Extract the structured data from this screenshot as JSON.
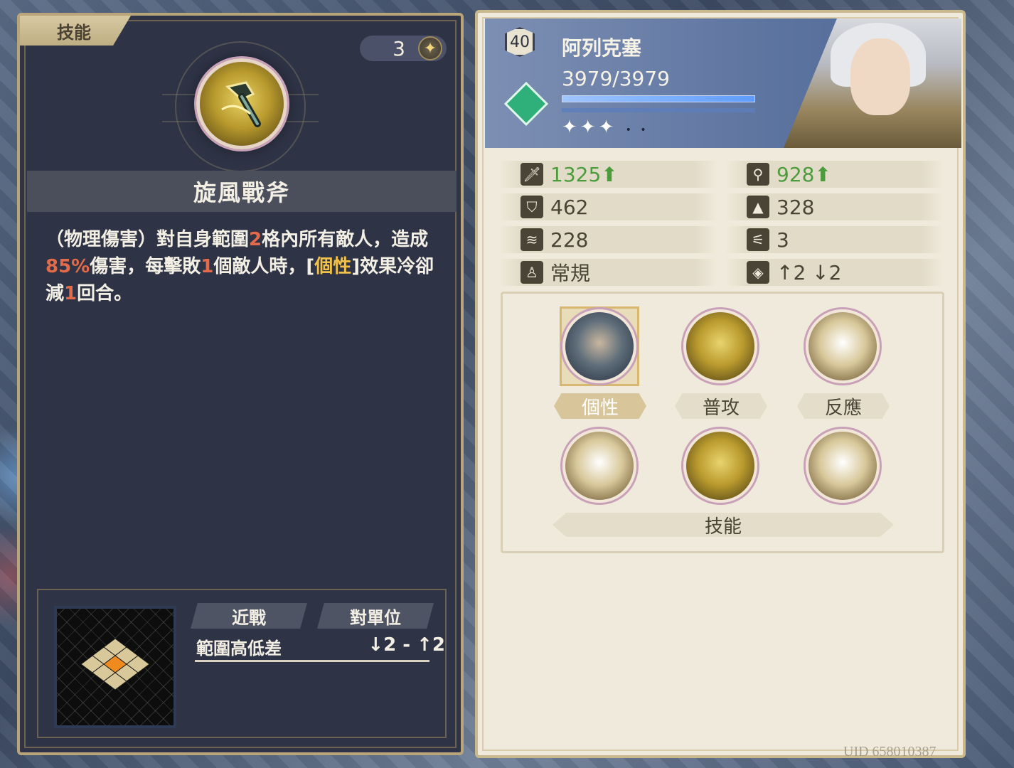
{
  "left_panel": {
    "tab_label": "技能",
    "cost_value": "3",
    "cost_icon": "diamond-star-icon",
    "skill_icon": "whirlwind-axe-icon",
    "skill_name": "旋風戰斧",
    "description": {
      "p1": "（物理傷害）對自身範圍",
      "n1": "2",
      "p2": "格內所有敵人，造成",
      "n2": "85%",
      "p3": "傷害，每擊敗",
      "n3": "1",
      "p4": "個敵人時，[",
      "kw": "個性",
      "p5": "]效果冷卻減",
      "n4": "1",
      "p6": "回合。"
    },
    "range": {
      "tag_melee": "近戰",
      "tag_target": "對單位",
      "height_label": "範圍高低差",
      "height_value": "↓2 - ↑2"
    }
  },
  "right_panel": {
    "level": "40",
    "name": "阿列克塞",
    "hp": "3979/3979",
    "hp_fraction": 1.0,
    "class_icon": "class-emblem-icon",
    "stars_filled": 3,
    "stars_empty": 2,
    "stars_text": "✦✦✦",
    "stars_dots": "• •",
    "stats": [
      {
        "icon": "sword-icon",
        "value": "1325⬆",
        "boosted": true
      },
      {
        "icon": "staff-icon",
        "value": "928⬆",
        "boosted": true
      },
      {
        "icon": "shield-icon",
        "value": "462",
        "boosted": false
      },
      {
        "icon": "wizard-hat-icon",
        "value": "328",
        "boosted": false
      },
      {
        "icon": "claw-icon",
        "value": "228",
        "boosted": false
      },
      {
        "icon": "boot-icon",
        "value": "3",
        "boosted": false
      },
      {
        "icon": "unit-type-icon",
        "value": "常規",
        "boosted": false
      },
      {
        "icon": "jump-icon",
        "value": "↑2 ↓2",
        "boosted": false
      }
    ],
    "abilities": {
      "trait_label": "個性",
      "normal_label": "普攻",
      "reaction_label": "反應",
      "skills_label": "技能"
    },
    "uid": "UID 658010387"
  }
}
